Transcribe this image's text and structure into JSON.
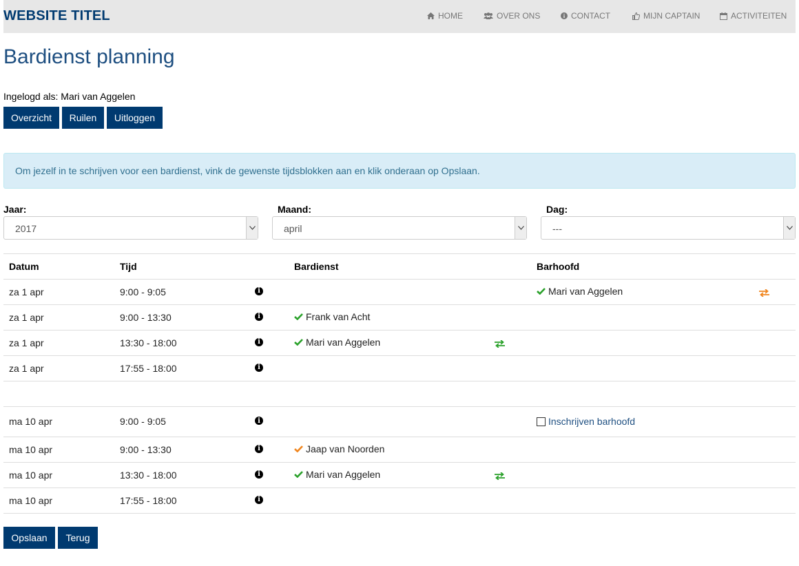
{
  "site": {
    "title": "WEBSITE TITEL"
  },
  "nav": [
    {
      "label": "HOME",
      "icon": "home-icon"
    },
    {
      "label": "OVER ONS",
      "icon": "users-icon"
    },
    {
      "label": "CONTACT",
      "icon": "info-circle-icon"
    },
    {
      "label": "MIJN CAPTAIN",
      "icon": "thumbs-up-icon"
    },
    {
      "label": "ACTIVITEITEN",
      "icon": "calendar-icon"
    }
  ],
  "page": {
    "title": "Bardienst planning"
  },
  "login": {
    "text": "Ingelogd als: Mari van Aggelen"
  },
  "actions": {
    "overview": "Overzicht",
    "swap": "Ruilen",
    "logout": "Uitloggen"
  },
  "alert": {
    "text": "Om jezelf in te schrijven voor een bardienst, vink de gewenste tijdsblokken aan en klik onderaan op Opslaan."
  },
  "filters": {
    "year": {
      "label": "Jaar:",
      "value": "2017"
    },
    "month": {
      "label": "Maand:",
      "value": "april"
    },
    "day": {
      "label": "Dag:",
      "value": "---"
    }
  },
  "table": {
    "headers": {
      "date": "Datum",
      "time": "Tijd",
      "bar": "Bardienst",
      "head": "Barhoofd"
    },
    "rows": [
      {
        "date": "za 1 apr",
        "time": "9:00 - 9:05",
        "head": "Mari van Aggelen",
        "head_status": "confirmed",
        "head_swap": "orange"
      },
      {
        "date": "za 1 apr",
        "time": "9:00 - 13:30",
        "bar": "Frank van Acht",
        "bar_status": "confirmed"
      },
      {
        "date": "za 1 apr",
        "time": "13:30 - 18:00",
        "bar": "Mari van Aggelen",
        "bar_status": "confirmed",
        "bar_swap": "green"
      },
      {
        "date": "za 1 apr",
        "time": "17:55 - 18:00"
      },
      {
        "date": "ma 10 apr",
        "time": "9:00 - 9:05",
        "head_signup": "Inschrijven barhoofd"
      },
      {
        "date": "ma 10 apr",
        "time": "9:00 - 13:30",
        "bar": "Jaap van Noorden",
        "bar_status": "pending"
      },
      {
        "date": "ma 10 apr",
        "time": "13:30 - 18:00",
        "bar": "Mari van Aggelen",
        "bar_status": "confirmed",
        "bar_swap": "green"
      },
      {
        "date": "ma 10 apr",
        "time": "17:55 - 18:00"
      }
    ]
  },
  "footer": {
    "save": "Opslaan",
    "back": "Terug"
  },
  "colors": {
    "brand": "#003a70",
    "title": "#1d4e80",
    "confirmed": "#2aa12a",
    "pending": "#f0851d",
    "swap_orange": "#f0851d",
    "swap_green": "#2aa12a",
    "alert_bg": "#d9edf7",
    "navbar_bg": "#e7e7e7"
  }
}
